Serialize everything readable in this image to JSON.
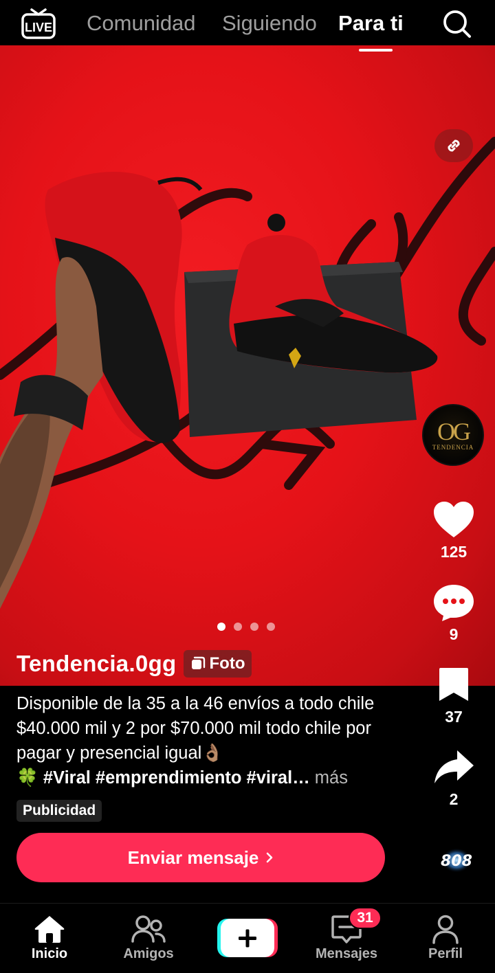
{
  "topbar": {
    "live_label": "LIVE",
    "tabs": [
      {
        "label": "Comunidad",
        "active": false
      },
      {
        "label": "Siguiendo",
        "active": false
      },
      {
        "label": "Para ti",
        "active": true
      }
    ]
  },
  "media": {
    "image_count": 4,
    "active_index": 0
  },
  "rail": {
    "avatar_monogram": "OG",
    "avatar_subtitle": "TENDENCIA",
    "likes": "125",
    "comments": "9",
    "saves": "37",
    "shares": "2",
    "sound_label": "808"
  },
  "post": {
    "username": "Tendencia.0gg",
    "type_badge": "Foto",
    "caption_text": "Disponible de la 35 a la 46 envíos a todo chile $40.000 mil y 2 por $70.000 mil todo chile por pagar y presencial igual👌🏽",
    "caption_tags": "🍀 #Viral #emprendimiento #viral…",
    "more_label": "más",
    "ad_label": "Publicidad",
    "cta_label": "Enviar mensaje"
  },
  "bottomnav": {
    "items": [
      {
        "label": "Inicio",
        "icon": "home-icon",
        "active": true
      },
      {
        "label": "Amigos",
        "icon": "friends-icon",
        "active": false
      },
      {
        "label": "",
        "icon": "plus-icon",
        "active": false
      },
      {
        "label": "Mensajes",
        "icon": "inbox-icon",
        "active": false
      },
      {
        "label": "Perfil",
        "icon": "profile-icon",
        "active": false
      }
    ],
    "messages_badge": "31"
  },
  "colors": {
    "accent": "#fe2c55",
    "background": "#000000",
    "media_red": "#e51218"
  }
}
